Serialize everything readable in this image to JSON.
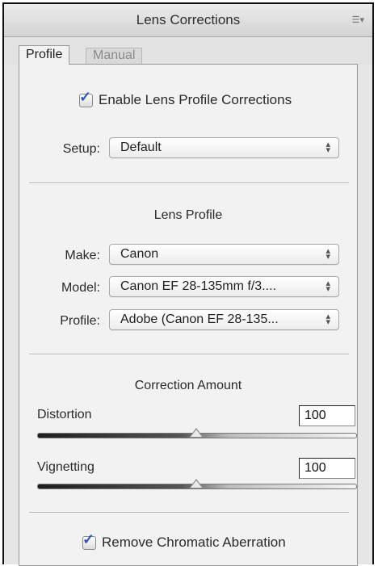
{
  "panel": {
    "title": "Lens Corrections",
    "menu_icon": "panel-menu-icon"
  },
  "tabs": [
    {
      "label": "Profile",
      "active": true
    },
    {
      "label": "Manual",
      "active": false
    }
  ],
  "enable_profile": {
    "label": "Enable Lens Profile Corrections",
    "checked": true
  },
  "setup": {
    "label": "Setup:",
    "value": "Default"
  },
  "lens_profile": {
    "heading": "Lens Profile",
    "make": {
      "label": "Make:",
      "value": "Canon"
    },
    "model": {
      "label": "Model:",
      "value": "Canon EF 28-135mm f/3...."
    },
    "profile": {
      "label": "Profile:",
      "value": "Adobe (Canon EF 28-135..."
    }
  },
  "correction_amount": {
    "heading": "Correction Amount",
    "distortion": {
      "label": "Distortion",
      "value": "100",
      "level": 100,
      "range": [
        0,
        200
      ]
    },
    "vignetting": {
      "label": "Vignetting",
      "value": "100",
      "level": 100,
      "range": [
        0,
        200
      ]
    }
  },
  "chromatic": {
    "label": "Remove Chromatic Aberration",
    "checked": true
  },
  "colors": {
    "check_accent": "#2a57c4",
    "panel_bg": "#f2f2f2"
  }
}
